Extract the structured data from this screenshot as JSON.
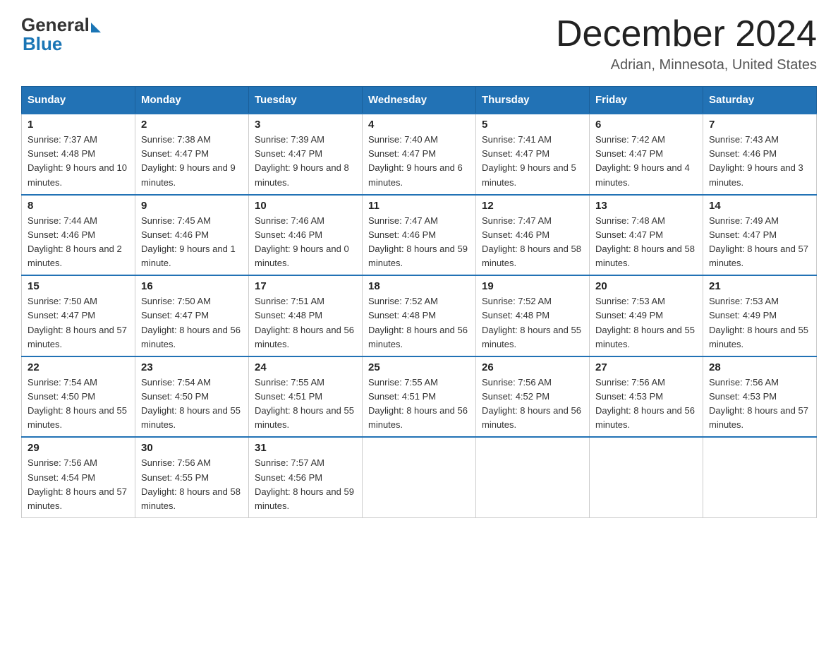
{
  "header": {
    "logo_general": "General",
    "logo_blue": "Blue",
    "title": "December 2024",
    "location": "Adrian, Minnesota, United States"
  },
  "days_of_week": [
    "Sunday",
    "Monday",
    "Tuesday",
    "Wednesday",
    "Thursday",
    "Friday",
    "Saturday"
  ],
  "weeks": [
    [
      {
        "day": "1",
        "sunrise": "7:37 AM",
        "sunset": "4:48 PM",
        "daylight": "9 hours and 10 minutes."
      },
      {
        "day": "2",
        "sunrise": "7:38 AM",
        "sunset": "4:47 PM",
        "daylight": "9 hours and 9 minutes."
      },
      {
        "day": "3",
        "sunrise": "7:39 AM",
        "sunset": "4:47 PM",
        "daylight": "9 hours and 8 minutes."
      },
      {
        "day": "4",
        "sunrise": "7:40 AM",
        "sunset": "4:47 PM",
        "daylight": "9 hours and 6 minutes."
      },
      {
        "day": "5",
        "sunrise": "7:41 AM",
        "sunset": "4:47 PM",
        "daylight": "9 hours and 5 minutes."
      },
      {
        "day": "6",
        "sunrise": "7:42 AM",
        "sunset": "4:47 PM",
        "daylight": "9 hours and 4 minutes."
      },
      {
        "day": "7",
        "sunrise": "7:43 AM",
        "sunset": "4:46 PM",
        "daylight": "9 hours and 3 minutes."
      }
    ],
    [
      {
        "day": "8",
        "sunrise": "7:44 AM",
        "sunset": "4:46 PM",
        "daylight": "8 hours and 2 minutes."
      },
      {
        "day": "9",
        "sunrise": "7:45 AM",
        "sunset": "4:46 PM",
        "daylight": "9 hours and 1 minute."
      },
      {
        "day": "10",
        "sunrise": "7:46 AM",
        "sunset": "4:46 PM",
        "daylight": "9 hours and 0 minutes."
      },
      {
        "day": "11",
        "sunrise": "7:47 AM",
        "sunset": "4:46 PM",
        "daylight": "8 hours and 59 minutes."
      },
      {
        "day": "12",
        "sunrise": "7:47 AM",
        "sunset": "4:46 PM",
        "daylight": "8 hours and 58 minutes."
      },
      {
        "day": "13",
        "sunrise": "7:48 AM",
        "sunset": "4:47 PM",
        "daylight": "8 hours and 58 minutes."
      },
      {
        "day": "14",
        "sunrise": "7:49 AM",
        "sunset": "4:47 PM",
        "daylight": "8 hours and 57 minutes."
      }
    ],
    [
      {
        "day": "15",
        "sunrise": "7:50 AM",
        "sunset": "4:47 PM",
        "daylight": "8 hours and 57 minutes."
      },
      {
        "day": "16",
        "sunrise": "7:50 AM",
        "sunset": "4:47 PM",
        "daylight": "8 hours and 56 minutes."
      },
      {
        "day": "17",
        "sunrise": "7:51 AM",
        "sunset": "4:48 PM",
        "daylight": "8 hours and 56 minutes."
      },
      {
        "day": "18",
        "sunrise": "7:52 AM",
        "sunset": "4:48 PM",
        "daylight": "8 hours and 56 minutes."
      },
      {
        "day": "19",
        "sunrise": "7:52 AM",
        "sunset": "4:48 PM",
        "daylight": "8 hours and 55 minutes."
      },
      {
        "day": "20",
        "sunrise": "7:53 AM",
        "sunset": "4:49 PM",
        "daylight": "8 hours and 55 minutes."
      },
      {
        "day": "21",
        "sunrise": "7:53 AM",
        "sunset": "4:49 PM",
        "daylight": "8 hours and 55 minutes."
      }
    ],
    [
      {
        "day": "22",
        "sunrise": "7:54 AM",
        "sunset": "4:50 PM",
        "daylight": "8 hours and 55 minutes."
      },
      {
        "day": "23",
        "sunrise": "7:54 AM",
        "sunset": "4:50 PM",
        "daylight": "8 hours and 55 minutes."
      },
      {
        "day": "24",
        "sunrise": "7:55 AM",
        "sunset": "4:51 PM",
        "daylight": "8 hours and 55 minutes."
      },
      {
        "day": "25",
        "sunrise": "7:55 AM",
        "sunset": "4:51 PM",
        "daylight": "8 hours and 56 minutes."
      },
      {
        "day": "26",
        "sunrise": "7:56 AM",
        "sunset": "4:52 PM",
        "daylight": "8 hours and 56 minutes."
      },
      {
        "day": "27",
        "sunrise": "7:56 AM",
        "sunset": "4:53 PM",
        "daylight": "8 hours and 56 minutes."
      },
      {
        "day": "28",
        "sunrise": "7:56 AM",
        "sunset": "4:53 PM",
        "daylight": "8 hours and 57 minutes."
      }
    ],
    [
      {
        "day": "29",
        "sunrise": "7:56 AM",
        "sunset": "4:54 PM",
        "daylight": "8 hours and 57 minutes."
      },
      {
        "day": "30",
        "sunrise": "7:56 AM",
        "sunset": "4:55 PM",
        "daylight": "8 hours and 58 minutes."
      },
      {
        "day": "31",
        "sunrise": "7:57 AM",
        "sunset": "4:56 PM",
        "daylight": "8 hours and 59 minutes."
      },
      null,
      null,
      null,
      null
    ]
  ],
  "labels": {
    "sunrise": "Sunrise:",
    "sunset": "Sunset:",
    "daylight": "Daylight:"
  }
}
